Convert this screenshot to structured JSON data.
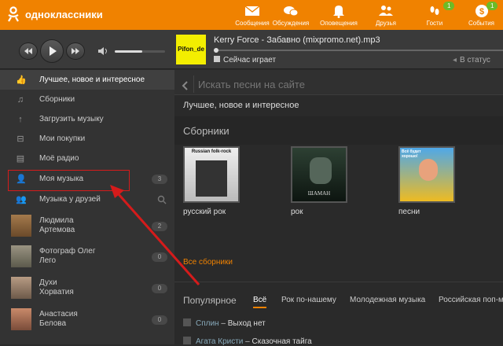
{
  "brand": {
    "name": "одноклассники",
    "accent": "#f08200",
    "badge_color": "#6dbb27"
  },
  "topnav": [
    {
      "label": "Сообщения",
      "icon": "envelope-icon"
    },
    {
      "label": "Обсуждения",
      "icon": "chat-bubbles-icon"
    },
    {
      "label": "Оповещения",
      "icon": "bell-icon"
    },
    {
      "label": "Друзья",
      "icon": "friends-icon"
    },
    {
      "label": "Гости",
      "icon": "footprints-icon",
      "badge": "1"
    },
    {
      "label": "События",
      "icon": "events-icon",
      "badge": "1"
    }
  ],
  "player": {
    "track": "Kerry Force - Забавно (mixpromo.net).mp3",
    "cover_text": "Pifon_de",
    "now_playing": "Сейчас играет",
    "to_status": "В статус",
    "volume_level": 0.55
  },
  "sidebar": {
    "items": [
      {
        "label": "Лучшее, новое и интересное",
        "icon": "thumbs-up-icon"
      },
      {
        "label": "Сборники",
        "icon": "collection-icon"
      },
      {
        "label": "Загрузить музыку",
        "icon": "upload-icon"
      },
      {
        "label": "Мои покупки",
        "icon": "cart-icon"
      },
      {
        "label": "Моё радио",
        "icon": "radio-icon"
      },
      {
        "label": "Моя музыка",
        "icon": "add-user-music-icon",
        "count": "3"
      },
      {
        "label": "Музыка у друзей",
        "icon": "friends-music-icon"
      }
    ],
    "friends": [
      {
        "line1": "Людмила",
        "line2": "Артемова",
        "count": "2"
      },
      {
        "line1": "Фотограф Олег",
        "line2": "Лего",
        "count": "0"
      },
      {
        "line1": "Духи",
        "line2": "Хорватия",
        "count": "0"
      },
      {
        "line1": "Анастасия",
        "line2": "Белова",
        "count": "0"
      }
    ]
  },
  "main": {
    "search_placeholder": "Искать песни на сайте",
    "breadcrumb": "Лучшее, новое и интересное",
    "collections_title": "Сборники",
    "albums": [
      {
        "caption": "русский рок",
        "art_text": "Russian folk-rock"
      },
      {
        "caption": "рок",
        "art_text": "ШАМАН"
      },
      {
        "caption": "песни",
        "art_text": "Всё будет хорошо!"
      }
    ],
    "all_collections": "Все сборники",
    "popular_title": "Популярное",
    "tabs": [
      "Всё",
      "Рок по-нашему",
      "Молодежная музыка",
      "Российская поп-м"
    ],
    "songs": [
      {
        "artist": "Сплин",
        "title": "Выход нет"
      },
      {
        "artist": "Агата Кристи",
        "title": "Сказочная тайга"
      }
    ]
  }
}
